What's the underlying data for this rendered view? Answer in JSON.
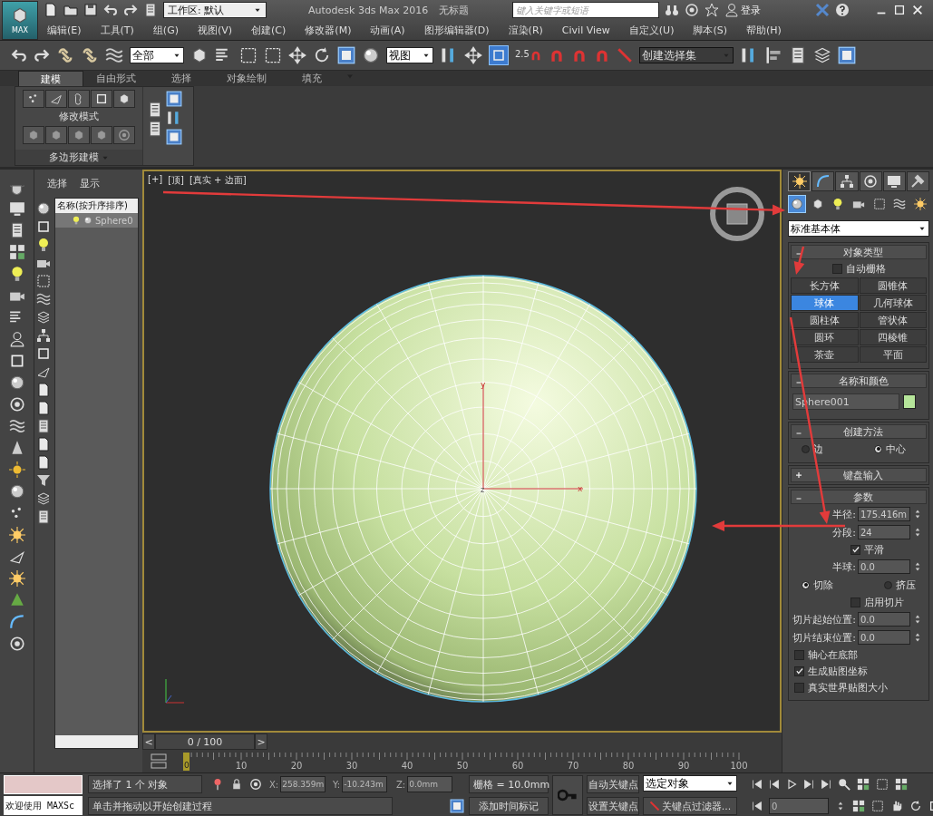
{
  "title_bar": {
    "app_menu": "MAX",
    "workspace": "工作区: 默认",
    "title": "Autodesk 3ds Max 2016",
    "document": "无标题",
    "search": {
      "placeholder": "键入关键字或短语"
    },
    "login": "登录"
  },
  "menu": [
    "编辑(E)",
    "工具(T)",
    "组(G)",
    "视图(V)",
    "创建(C)",
    "修改器(M)",
    "动画(A)",
    "图形编辑器(D)",
    "渲染(R)",
    "Civil View",
    "自定义(U)",
    "脚本(S)",
    "帮助(H)"
  ],
  "main_toolbar": {
    "selection_filter": "全部",
    "reference_coord": "视图",
    "snap_value": "2.5",
    "named_selection": "创建选择集"
  },
  "ribbon": {
    "tabs": [
      {
        "label": "建模",
        "selected": true
      },
      {
        "label": "自由形式",
        "selected": false
      },
      {
        "label": "选择",
        "selected": false
      },
      {
        "label": "对象绘制",
        "selected": false
      },
      {
        "label": "填充",
        "selected": false
      }
    ],
    "panel_title": "修改模式",
    "panel_footer": "多边形建模"
  },
  "scene_explorer": {
    "tabs": [
      "选择",
      "显示"
    ],
    "column": "名称(按升序排序)",
    "rows": [
      {
        "name": "Sphere0",
        "selected": true
      }
    ]
  },
  "viewport": {
    "labels": [
      "[+]",
      "[顶]",
      "[真实 + 边面]"
    ],
    "axis_labels": [
      "y",
      "z",
      "x"
    ]
  },
  "command_panel": {
    "tabs": [
      {
        "selected": true
      },
      {
        "selected": false
      },
      {
        "selected": false
      },
      {
        "selected": false
      },
      {
        "selected": false
      },
      {
        "selected": false
      }
    ],
    "categories": [
      {
        "selected": true
      },
      {
        "selected": false
      },
      {
        "selected": false
      },
      {
        "selected": false
      },
      {
        "selected": false
      },
      {
        "selected": false
      },
      {
        "selected": false
      }
    ],
    "type": "标准基本体",
    "object_type": {
      "title": "对象类型",
      "expanded": true,
      "auto_grid": {
        "label": "自动栅格",
        "checked": false
      },
      "buttons": [
        {
          "label": "长方体",
          "selected": false
        },
        {
          "label": "圆锥体",
          "selected": false
        },
        {
          "label": "球体",
          "selected": true
        },
        {
          "label": "几何球体",
          "selected": false
        },
        {
          "label": "圆柱体",
          "selected": false
        },
        {
          "label": "管状体",
          "selected": false
        },
        {
          "label": "圆环",
          "selected": false
        },
        {
          "label": "四棱锥",
          "selected": false
        },
        {
          "label": "茶壶",
          "selected": false
        },
        {
          "label": "平面",
          "selected": false
        }
      ]
    },
    "name_and_color": {
      "title": "名称和颜色",
      "expanded": true,
      "name": "Sphere001",
      "color": "#b6e59a"
    },
    "creation_method": {
      "title": "创建方法",
      "expanded": true,
      "options": [
        {
          "label": "边",
          "selected": false
        },
        {
          "label": "中心",
          "selected": true
        }
      ]
    },
    "keyboard_entry": {
      "title": "键盘输入",
      "expanded": false
    },
    "parameters": {
      "title": "参数",
      "expanded": true,
      "items": [
        {
          "kind": "spinner",
          "label": "半径:",
          "value": "175.416m"
        },
        {
          "kind": "spinner",
          "label": "分段:",
          "value": "24"
        },
        {
          "kind": "sub_checkbox",
          "label": "平滑",
          "checked": true
        },
        {
          "kind": "spinner",
          "label": "半球:",
          "value": "0.0"
        },
        {
          "kind": "radios",
          "options": [
            {
              "label": "切除",
              "selected": true
            },
            {
              "label": "挤压",
              "selected": false
            }
          ]
        },
        {
          "kind": "sub_checkbox",
          "label": "启用切片",
          "checked": false
        },
        {
          "kind": "spinner",
          "label": "切片起始位置:",
          "value": "0.0"
        },
        {
          "kind": "spinner",
          "label": "切片结束位置:",
          "value": "0.0"
        },
        {
          "kind": "checkbox",
          "label": "轴心在底部",
          "checked": false
        },
        {
          "kind": "checkbox",
          "label": "生成贴图坐标",
          "checked": true
        },
        {
          "kind": "checkbox",
          "label": "真实世界贴图大小",
          "checked": false
        }
      ]
    }
  },
  "time_slider": {
    "prev": "<",
    "position": "0 / 100",
    "next": ">",
    "frame_marker": "0",
    "ticks": [
      "10",
      "20",
      "30",
      "40",
      "50",
      "60",
      "70",
      "80",
      "90",
      "100"
    ]
  },
  "status_bar": {
    "listener_input": "欢迎使用 MAXSc",
    "selection": "选择了 1 个 对象",
    "coords": [
      {
        "axis": "X:",
        "value": "258.359m"
      },
      {
        "axis": "Y:",
        "value": "-10.243m"
      },
      {
        "axis": "Z:",
        "value": "0.0mm"
      }
    ],
    "grid": "栅格 = 10.0mm",
    "prompt": "单击并拖动以开始创建过程",
    "add_time_tag": "添加时间标记",
    "auto_key": "自动关键点",
    "set_key": "设置关键点",
    "key_mode": "选定对象",
    "key_filters": "关键点过滤器...",
    "frame": "0"
  }
}
